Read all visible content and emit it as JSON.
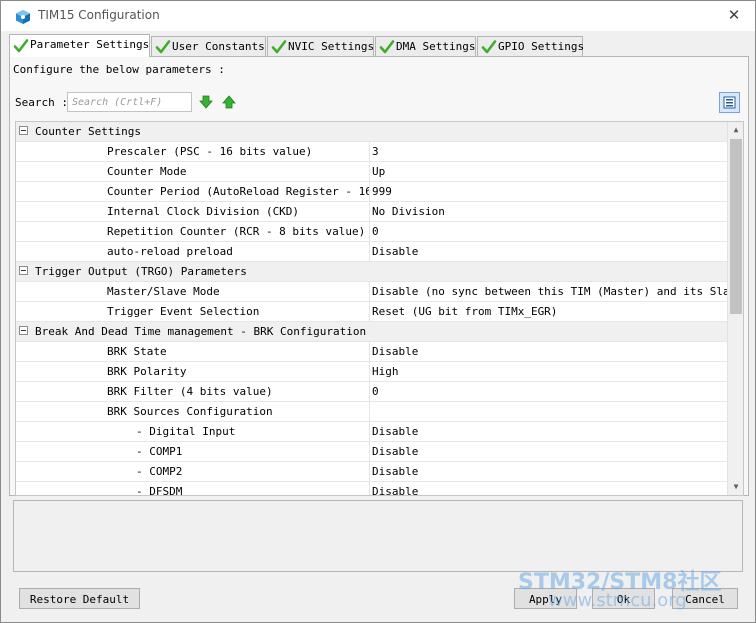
{
  "window": {
    "title": "TIM15 Configuration",
    "close_glyph": "✕"
  },
  "tabs": [
    {
      "label": "Parameter Settings",
      "active": true
    },
    {
      "label": "User Constants",
      "active": false
    },
    {
      "label": "NVIC Settings",
      "active": false
    },
    {
      "label": "DMA Settings",
      "active": false
    },
    {
      "label": "GPIO Settings",
      "active": false
    }
  ],
  "panel": {
    "configure_text": "Configure the below parameters :",
    "search_label": "Search :",
    "search_placeholder": "Search (Crtl+F)",
    "search_value": ""
  },
  "sections": [
    {
      "name": "Counter Settings",
      "params": [
        {
          "name": "Prescaler (PSC - 16 bits value)",
          "value": "3"
        },
        {
          "name": "Counter Mode",
          "value": "Up"
        },
        {
          "name": "Counter Period (AutoReload Register - 16...",
          "value": "999"
        },
        {
          "name": "Internal Clock Division (CKD)",
          "value": "No Division"
        },
        {
          "name": "Repetition Counter (RCR - 8 bits value)",
          "value": "0"
        },
        {
          "name": "auto-reload preload",
          "value": "Disable"
        }
      ]
    },
    {
      "name": "Trigger Output (TRGO) Parameters",
      "params": [
        {
          "name": "Master/Slave Mode",
          "value": "Disable (no sync between this TIM (Master) and its Slaves"
        },
        {
          "name": "Trigger Event Selection",
          "value": "Reset (UG bit from TIMx_EGR)"
        }
      ]
    },
    {
      "name": "Break And Dead Time management - BRK Configuration",
      "params": [
        {
          "name": "BRK State",
          "value": "Disable"
        },
        {
          "name": "BRK Polarity",
          "value": "High"
        },
        {
          "name": "BRK Filter (4 bits value)",
          "value": "0"
        },
        {
          "name": "BRK Sources Configuration",
          "value": ""
        },
        {
          "name": "- Digital Input",
          "value": "Disable",
          "sub": true
        },
        {
          "name": "- COMP1",
          "value": "Disable",
          "sub": true
        },
        {
          "name": "- COMP2",
          "value": "Disable",
          "sub": true
        },
        {
          "name": "- DFSDM",
          "value": "Disable",
          "sub": true
        }
      ]
    }
  ],
  "buttons": {
    "restore_default": "Restore Default",
    "apply": "Apply",
    "ok": "Ok",
    "cancel": "Cancel"
  },
  "watermark": {
    "line1": "STM32/STM8社区",
    "line2": "www.stmcu.org"
  },
  "colors": {
    "check_green": "#3fae2a",
    "arrow_green": "#35b233",
    "app_icon_blue": "#2a8fd8",
    "background_app_blue": "#1e8bd4"
  },
  "icons": {
    "app": "cube-icon",
    "tab_status": "green-check-icon",
    "next_match": "arrow-down-icon",
    "previous_match": "arrow-up-icon",
    "view_toggle": "list-view-icon",
    "section_toggle": "collapse-minus-icon"
  }
}
